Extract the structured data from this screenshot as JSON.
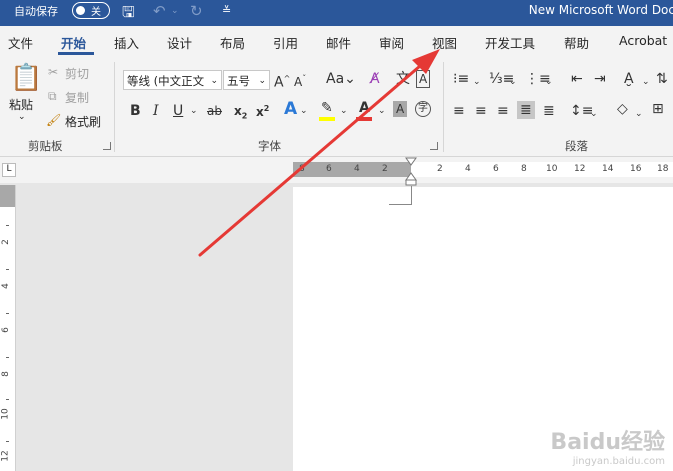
{
  "titlebar": {
    "autosave_label": "自动保存",
    "autosave_state": "关",
    "doc_title": "New Microsoft Word Doc"
  },
  "tabs": [
    {
      "label": "文件"
    },
    {
      "label": "开始"
    },
    {
      "label": "插入"
    },
    {
      "label": "设计"
    },
    {
      "label": "布局"
    },
    {
      "label": "引用"
    },
    {
      "label": "邮件"
    },
    {
      "label": "审阅"
    },
    {
      "label": "视图"
    },
    {
      "label": "开发工具"
    },
    {
      "label": "帮助"
    },
    {
      "label": "Acrobat"
    }
  ],
  "active_tab": "开始",
  "clipboard": {
    "paste": "粘贴",
    "cut": "剪切",
    "copy": "复制",
    "format_painter": "格式刷",
    "group_label": "剪贴板"
  },
  "font": {
    "font_name": "等线 (中文正文",
    "font_size": "五号",
    "group_label": "字体"
  },
  "paragraph": {
    "group_label": "段落"
  },
  "ruler": {
    "left_numbers": [
      "8",
      "6",
      "4",
      "2"
    ],
    "right_numbers": [
      "2",
      "4",
      "6",
      "8",
      "10",
      "12",
      "14",
      "16",
      "18"
    ],
    "vertical_numbers": [
      "2",
      "4",
      "6",
      "8",
      "10",
      "12"
    ]
  },
  "watermark": {
    "brand": "Baidu经验",
    "url": "jingyan.baidu.com"
  },
  "colors": {
    "titlebar": "#2b579a",
    "ribbon": "#f3f3f3",
    "arrow": "#e53935",
    "highlight": "#ffff00",
    "font_color": "#e53935"
  }
}
